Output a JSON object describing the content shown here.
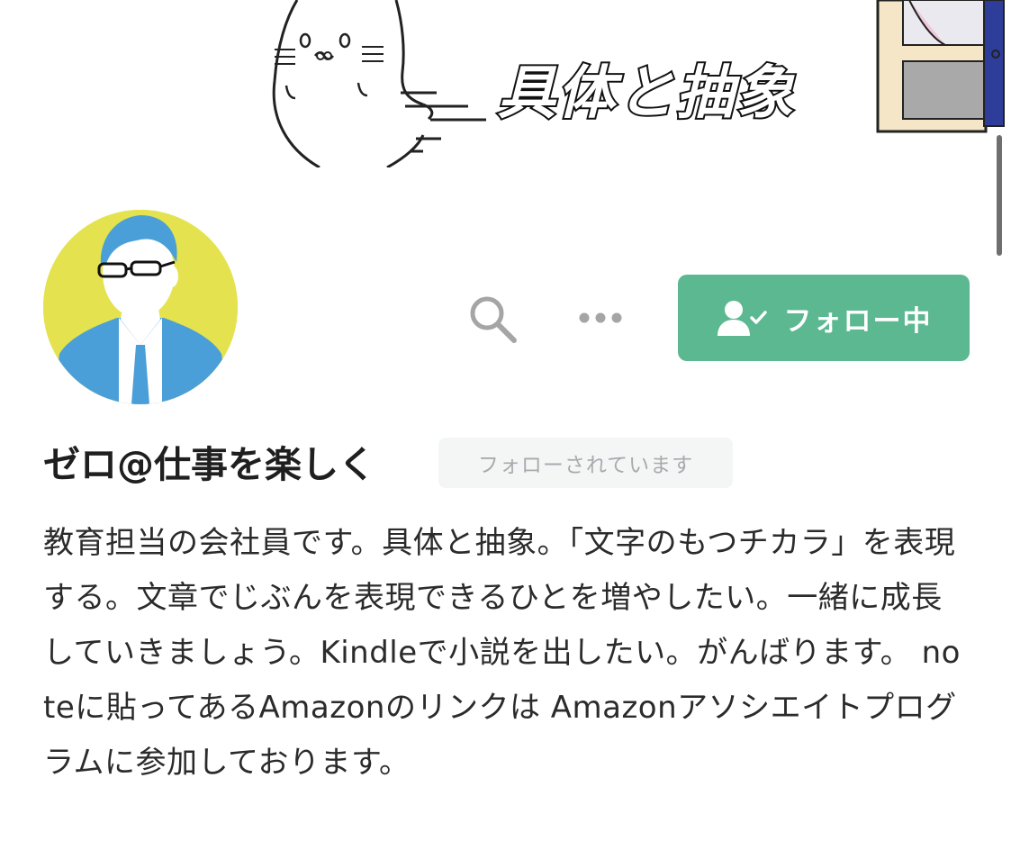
{
  "banner": {
    "title": "具体と抽象"
  },
  "profile": {
    "name": "ゼロ@仕事を楽しく",
    "follows_you": "フォローされています",
    "bio": "教育担当の会社員です。具体と抽象。「文字のもつチカラ」を表現する。文章でじぶんを表現できるひとを増やしたい。一緒に成長していきましょう。Kindleで小説を出したい。がんばります。 noteに貼ってあるAmazonのリンクは Amazonアソシエイトプログラムに参加しております。"
  },
  "actions": {
    "follow_label": "フォロー中"
  },
  "icons": {
    "search": "search-icon",
    "more": "more-icon",
    "follow_state": "user-check-icon"
  },
  "colors": {
    "accent": "#5cb891",
    "badge_bg": "#f4f6f6",
    "badge_text": "#a6abad",
    "avatar_bg": "#e4e24e",
    "avatar_figure": "#4a9fd8"
  }
}
